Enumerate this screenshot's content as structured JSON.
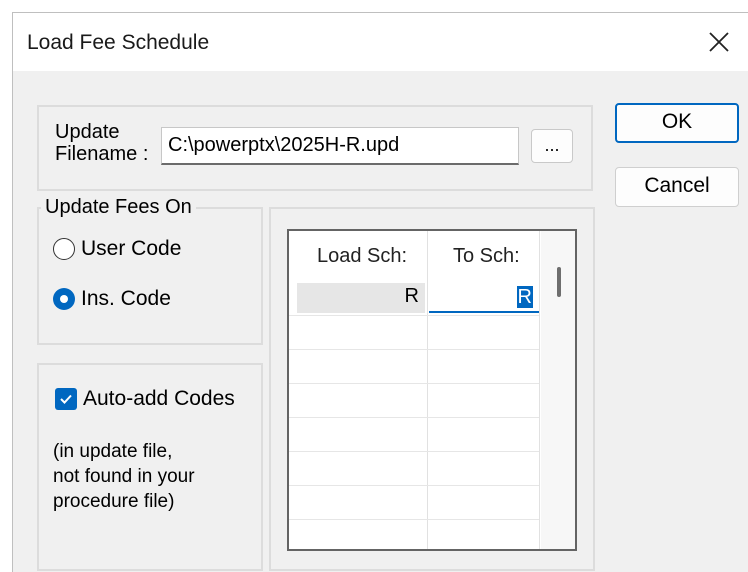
{
  "window": {
    "title": "Load Fee Schedule",
    "close_glyph": "✕"
  },
  "file": {
    "label_line1": "Update",
    "label_line2": "Filename :",
    "value": "C:\\powerptx\\2025H-R.upd",
    "browse_label": "..."
  },
  "buttons": {
    "ok": "OK",
    "cancel": "Cancel"
  },
  "update_fees": {
    "legend": "Update Fees On",
    "options": [
      {
        "label": "User Code",
        "selected": false
      },
      {
        "label": "Ins. Code",
        "selected": true
      }
    ]
  },
  "auto_add": {
    "label": "Auto-add Codes",
    "checked": true,
    "note_lines": [
      "(in update file,",
      "not found in your",
      "procedure file)"
    ]
  },
  "grid": {
    "headers": [
      "Load Sch:",
      "To Sch:"
    ],
    "rows": [
      [
        "R",
        "R"
      ]
    ]
  },
  "colors": {
    "accent": "#0067c0",
    "background": "#f0f0f0"
  },
  "icons": {
    "close": "close-icon",
    "check": "check-icon"
  }
}
